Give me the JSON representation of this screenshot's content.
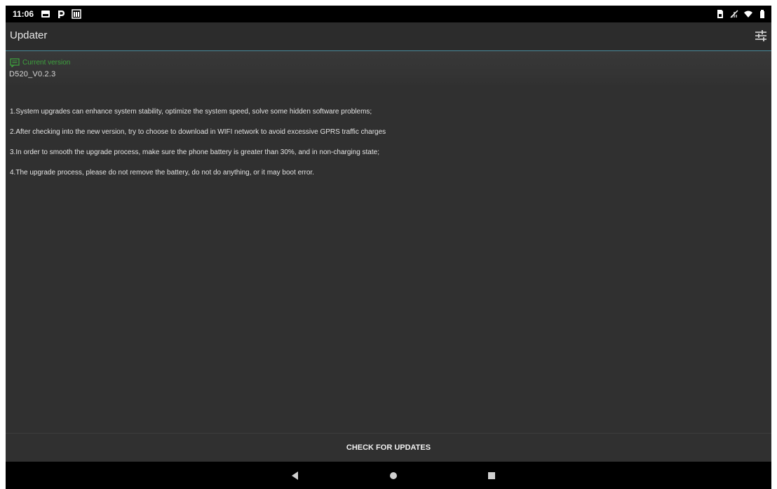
{
  "status_bar": {
    "time": "11:06",
    "left_icons": [
      "image-notification-icon",
      "p-app-notification-icon",
      "calendar-notification-icon"
    ],
    "right_icons": [
      "sim-icon",
      "no-signal-icon",
      "wifi-icon",
      "battery-icon"
    ]
  },
  "app_bar": {
    "title": "Updater",
    "settings_icon": "tune-settings-icon"
  },
  "version": {
    "label": "Current version",
    "value": "D520_V0.2.3",
    "icon": "version-doc-icon",
    "label_color": "#3ea33e"
  },
  "notes": [
    "1.System upgrades can enhance system stability, optimize the system speed, solve some hidden software problems;",
    "2.After checking into the new version, try to choose to download in WIFI network to avoid excessive GPRS traffic charges",
    "3.In order to smooth the upgrade process, make sure the phone battery is greater than 30%, and in non-charging state;",
    "4.The upgrade process, please do not remove the battery, do not do anything, or it may boot error."
  ],
  "actions": {
    "check_updates_label": "CHECK FOR UPDATES"
  },
  "nav_bar": {
    "buttons": [
      "back-icon",
      "home-icon",
      "recents-icon"
    ]
  },
  "colors": {
    "background": "#303030",
    "app_bar": "#2c2c2c",
    "status_bar": "#000000",
    "accent_line": "#4a8a9a",
    "text": "#e4e4e4"
  }
}
